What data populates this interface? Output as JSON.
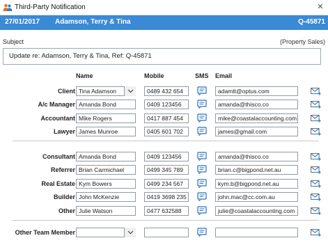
{
  "window": {
    "title": "Third-Party Notification"
  },
  "header": {
    "date": "27/01/2017",
    "client_name": "Adamson, Terry & Tina",
    "ref": "Q-45871",
    "bg_color": "#3a8ad6"
  },
  "subject": {
    "label": "Subject",
    "category": "(Property Sales)",
    "value": "Update re: Adamson, Terry & Tina, Ref: Q-45871"
  },
  "columns": {
    "name": "Name",
    "mobile": "Mobile",
    "sms": "SMS",
    "email": "Email"
  },
  "group1": [
    {
      "role": "Client",
      "name": "Tina Adamson",
      "mobile": "0489 432 654",
      "email": "adamtt@optus.com",
      "dropdown": true
    },
    {
      "role": "A/c Manager",
      "name": "Amanda Bond",
      "mobile": "0409 123456",
      "email": "amanda@thisco.co"
    },
    {
      "role": "Accountant",
      "name": "Mike Rogers",
      "mobile": "0417 887 454",
      "email": "mike@coastalaccounting.com"
    },
    {
      "role": "Lawyer",
      "name": "James Munroe",
      "mobile": "0405 601 702",
      "email": "james@gmail.com"
    }
  ],
  "group2": [
    {
      "role": "Consultant",
      "name": "Amanda Bond",
      "mobile": "0409 123456",
      "email": "amanda@thisco.co"
    },
    {
      "role": "Referrer",
      "name": "Brian Carmichael",
      "mobile": "0499 345 789",
      "email": "brian.c@bigpond.net.au"
    },
    {
      "role": "Real Estate",
      "name": "Kym Bowers",
      "mobile": "0499 234 567",
      "email": "kym.b@bigpond.net.au"
    },
    {
      "role": "Builder",
      "name": "John McKenzie",
      "mobile": "0419 3698 235",
      "email": "john.mac@cc.com.au"
    },
    {
      "role": "Other",
      "name": "Julie Watson",
      "mobile": "0477 632588",
      "email": "julie@coastalaccounting.com"
    }
  ],
  "group3": [
    {
      "role": "Other Team Member",
      "name": "",
      "mobile": "",
      "email": "",
      "dropdown": true
    }
  ]
}
